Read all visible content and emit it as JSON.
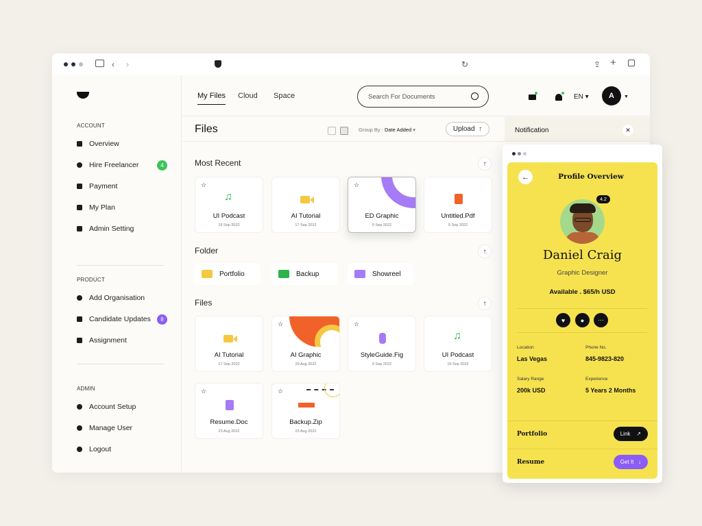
{
  "sidebar": {
    "sections": [
      {
        "label": "ACCOUNT",
        "items": [
          {
            "label": "Overview"
          },
          {
            "label": "Hire Freelancer",
            "badge": "4",
            "badge_color": "#3cc45a"
          },
          {
            "label": "Payment"
          },
          {
            "label": "My Plan"
          },
          {
            "label": "Admin Setting"
          }
        ]
      },
      {
        "label": "PRODUCT",
        "items": [
          {
            "label": "Add Organisation"
          },
          {
            "label": "Candidate Updates",
            "badge": "8",
            "badge_color": "#8b5cf6"
          },
          {
            "label": "Assignment"
          }
        ]
      },
      {
        "label": "ADMIN",
        "items": [
          {
            "label": "Account Setup"
          },
          {
            "label": "Manage User"
          },
          {
            "label": "Logout"
          }
        ]
      }
    ]
  },
  "topnav": {
    "tabs": [
      "My Files",
      "Cloud",
      "Space"
    ],
    "active_tab": "My Files",
    "search_placeholder": "Search For Documents",
    "language": "EN"
  },
  "files_header": {
    "title": "Files",
    "group_by_label": "Group By :",
    "group_by_value": "Date Added",
    "upload_label": "Upload"
  },
  "notification": {
    "title": "Notification"
  },
  "most_recent": {
    "title": "Most Recent",
    "items": [
      {
        "name": "UI Podcast",
        "date": "16 Sep 2022",
        "icon": "music-note-icon",
        "color": "#2fb34a"
      },
      {
        "name": "AI Tutorial",
        "date": "17 Sep 2022",
        "icon": "video-camera-icon",
        "color": "#f5c842"
      },
      {
        "name": "ED Graphic",
        "date": "9 Sep 2022",
        "icon": "graphic-thumbnail",
        "color": "#a57cf5"
      },
      {
        "name": "Untitled.Pdf",
        "date": "9 Sep 2022",
        "icon": "document-icon",
        "color": "#f0622a"
      }
    ]
  },
  "folders": {
    "title": "Folder",
    "items": [
      {
        "name": "Portfolio",
        "color": "#f5c842"
      },
      {
        "name": "Backup",
        "color": "#2fb34a"
      },
      {
        "name": "Showreel",
        "color": "#a57cf5"
      }
    ]
  },
  "files": {
    "title": "Files",
    "items": [
      {
        "name": "AI Tutorial",
        "date": "17 Sep 2022",
        "icon": "video-camera-icon",
        "color": "#f5c842"
      },
      {
        "name": "AI Graphic",
        "date": "29 Aug 2022",
        "icon": "graphic-thumbnail",
        "color": "#f0622a"
      },
      {
        "name": "StyleGuide.Fig",
        "date": "9 Sep 2022",
        "icon": "figma-icon",
        "color": "#a57cf5"
      },
      {
        "name": "UI Podcast",
        "date": "16 Sep 2022",
        "icon": "music-note-icon",
        "color": "#2fb34a"
      },
      {
        "name": "Resume.Doc",
        "date": "23 Aug 2022",
        "icon": "document-icon",
        "color": "#a57cf5"
      },
      {
        "name": "Backup.Zip",
        "date": "23 Aug 2022",
        "icon": "zip-thumbnail",
        "color": "#f0622a"
      }
    ]
  },
  "profile": {
    "title": "Profile Overview",
    "rating": "4.2",
    "name": "Daniel Craig",
    "role": "Graphic Designer",
    "availability": "Available . $65/h USD",
    "card_color": "#f6e24f",
    "info": [
      {
        "label": "Location",
        "value": "Las Vegas"
      },
      {
        "label": "Phone No.",
        "value": "845-9823-820"
      },
      {
        "label": "Salary Range",
        "value": "200k USD"
      },
      {
        "label": "Experience",
        "value": "5 Years 2 Months"
      }
    ],
    "portfolio_label": "Portfolio",
    "portfolio_button": "Link",
    "resume_label": "Resume",
    "resume_button": "Get It"
  }
}
